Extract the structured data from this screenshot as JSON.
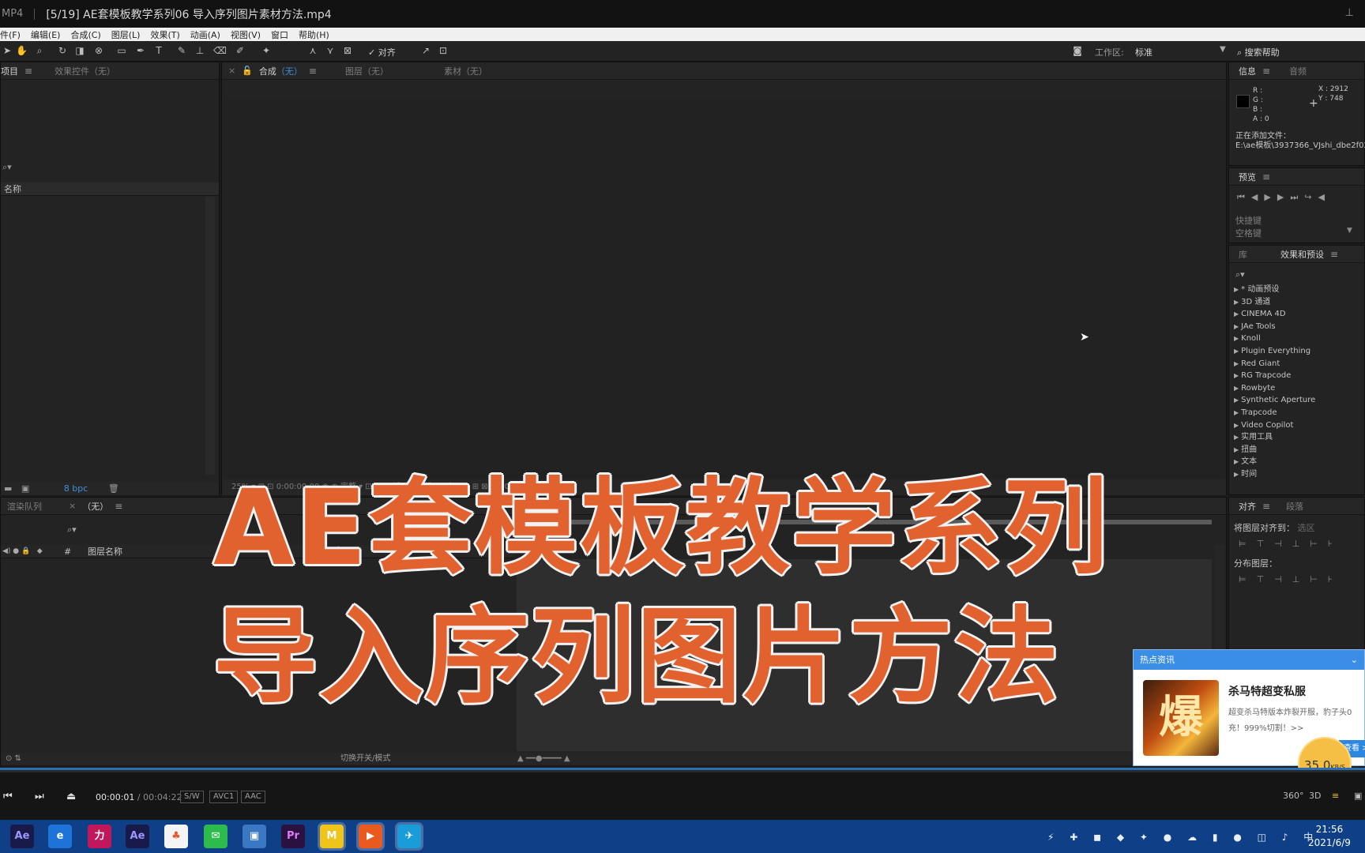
{
  "player": {
    "format": "MP4",
    "title": "[5/19] AE套模板教学系列06 导入序列图片素材方法.mp4",
    "pin_icon": "pin-icon"
  },
  "menu": [
    "件(F)",
    "编辑(E)",
    "合成(C)",
    "图层(L)",
    "效果(T)",
    "动画(A)",
    "视图(V)",
    "窗口",
    "帮助(H)"
  ],
  "toolbar": {
    "align_check": "对齐",
    "workspace_label": "工作区:",
    "workspace_value": "标准",
    "help_search": "搜索帮助"
  },
  "project_panel": {
    "tab_project": "项目",
    "tab_effect_controls": "效果控件（无）",
    "column_name": "名称",
    "bpc": "8 bpc"
  },
  "comp_panel": {
    "tab_comp": "合成",
    "tab_comp_value": "（无）",
    "tab_layer": "图层（无）",
    "tab_footage": "素材（无）",
    "footer": "25%   ▾   ⊞   ⊡   0:00:00:00   ◉   ⊕   完整   ▾   ⊡   ⊞   ⊠   活动摄像机   ▾   1个   ▾   ⊡   ⊞   ⊠   +0.0"
  },
  "info_panel": {
    "tab_info": "信息",
    "tab_audio": "音频",
    "r": "R :",
    "g": "G :",
    "b": "B :",
    "a": "A : 0",
    "x": "X : 2912",
    "y": "Y : 748",
    "status_line1": "正在添加文件：",
    "status_line2": "E:\\ae模板\\3937366_VJshi_dbe2f02"
  },
  "preview_panel": {
    "tab": "预览",
    "shortcut_label": "快捷键",
    "shortcut_value": "空格键"
  },
  "effects_panel": {
    "tab_library": "库",
    "tab_effects": "效果和预设",
    "items": [
      "* 动画预设",
      "3D 通道",
      "CINEMA 4D",
      "JAe Tools",
      "Knoll",
      "Plugin Everything",
      "Red Giant",
      "RG Trapcode",
      "Rowbyte",
      "Synthetic Aperture",
      "Trapcode",
      "Video Copilot",
      "实用工具",
      "扭曲",
      "文本",
      "时间"
    ]
  },
  "timeline_panel": {
    "tab_render": "渲染队列",
    "tab_comp": "（无）",
    "col_hash": "#",
    "col_layer_name": "图层名称",
    "footer_mode": "切换开关/模式"
  },
  "align_panel": {
    "tab_align": "对齐",
    "tab_paragraph": "段落",
    "align_to_label": "将图层对齐到：",
    "align_to_value": "选区",
    "distribute_label": "分布图层："
  },
  "overlay": {
    "line1": "AE套模板教学系列",
    "line2": "导入序列图片方法"
  },
  "popup": {
    "header": "热点资讯",
    "thumb_text": "爆",
    "title": "杀马特超变私服",
    "desc": "超变杀马特版本炸裂开服，豹子头0充！999%切割！>>",
    "button": "查看 >",
    "speed_value": "35.0",
    "speed_unit": "KB/S"
  },
  "controls": {
    "current_time": "00:00:01",
    "separator": " / ",
    "duration": "00:04:22",
    "badge_sw": "S/W",
    "badge_codec": "AVC1",
    "badge_audio": "AAC",
    "right_360": "360°",
    "right_3d": "3D"
  },
  "taskbar": {
    "apps": [
      {
        "label": "Ae",
        "color": "#1a1a4a",
        "fg": "#9999ff"
      },
      {
        "label": "e",
        "color": "#1e73d8",
        "fg": "#ffffff"
      },
      {
        "label": "力",
        "color": "#c2185b",
        "fg": "#ffffff"
      },
      {
        "label": "Ae",
        "color": "#1a1a4a",
        "fg": "#9999ff"
      },
      {
        "label": "♣",
        "color": "#f4f4f4",
        "fg": "#e05a2b"
      },
      {
        "label": "✉",
        "color": "#2dbb4e",
        "fg": "#ffffff"
      },
      {
        "label": "▣",
        "color": "#3b78c4",
        "fg": "#ffffff"
      },
      {
        "label": "Pr",
        "color": "#2a1140",
        "fg": "#e07cf7"
      },
      {
        "label": "M",
        "color": "#f0c419",
        "fg": "#ffffff"
      },
      {
        "label": "▶",
        "color": "#e85a1d",
        "fg": "#ffffff"
      },
      {
        "label": "✈",
        "color": "#1a9cd8",
        "fg": "#ffffff"
      }
    ],
    "tray": "⚡ ✚ ◼ ◆ ✦ ● ☁ ▮ ● ◫ ♪ 中",
    "time": "21:56",
    "date": "2021/6/9"
  }
}
